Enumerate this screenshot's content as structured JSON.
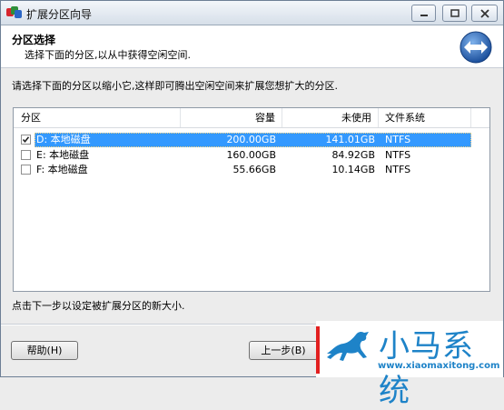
{
  "window": {
    "title": "扩展分区向导"
  },
  "header": {
    "title": "分区选择",
    "subtitle": "选择下面的分区,以从中获得空闲空间."
  },
  "instruction": "请选择下面的分区以缩小它,这样即可腾出空闲空间来扩展您想扩大的分区.",
  "table": {
    "columns": [
      "分区",
      "容量",
      "未使用",
      "文件系统"
    ],
    "rows": [
      {
        "name": "D: 本地磁盘",
        "capacity": "200.00GB",
        "unused": "141.01GB",
        "fs": "NTFS",
        "checked": true,
        "selected": true
      },
      {
        "name": "E: 本地磁盘",
        "capacity": "160.00GB",
        "unused": "84.92GB",
        "fs": "NTFS",
        "checked": false,
        "selected": false
      },
      {
        "name": "F: 本地磁盘",
        "capacity": "55.66GB",
        "unused": "10.14GB",
        "fs": "NTFS",
        "checked": false,
        "selected": false
      }
    ]
  },
  "status_text": "点击下一步以设定被扩展分区的新大小.",
  "buttons": {
    "help": "帮助(H)",
    "back": "上一步(B)"
  },
  "watermark": {
    "text": "小马系统",
    "url": "www.xiaomaxitong.com"
  },
  "icons": {
    "app": "app-logo-icon",
    "minimize": "minimize-icon",
    "maximize": "maximize-icon",
    "close": "close-icon",
    "header_logo": "double-arrow-icon",
    "checkmark": "checkmark-icon"
  }
}
